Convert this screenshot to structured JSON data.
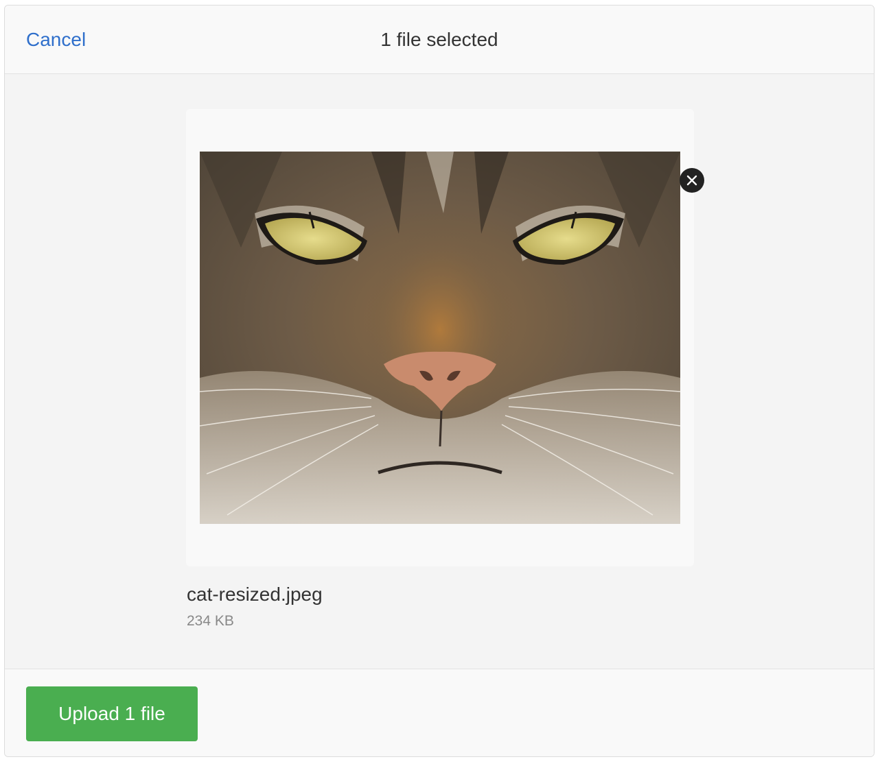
{
  "header": {
    "cancel_label": "Cancel",
    "title": "1 file selected"
  },
  "file": {
    "name": "cat-resized.jpeg",
    "size": "234 KB",
    "preview_icon": "image-thumbnail",
    "remove_icon": "close-icon"
  },
  "footer": {
    "upload_label": "Upload 1 file"
  },
  "colors": {
    "accent_link": "#2f6fcb",
    "upload_button": "#4aae50",
    "remove_button": "#222222"
  }
}
